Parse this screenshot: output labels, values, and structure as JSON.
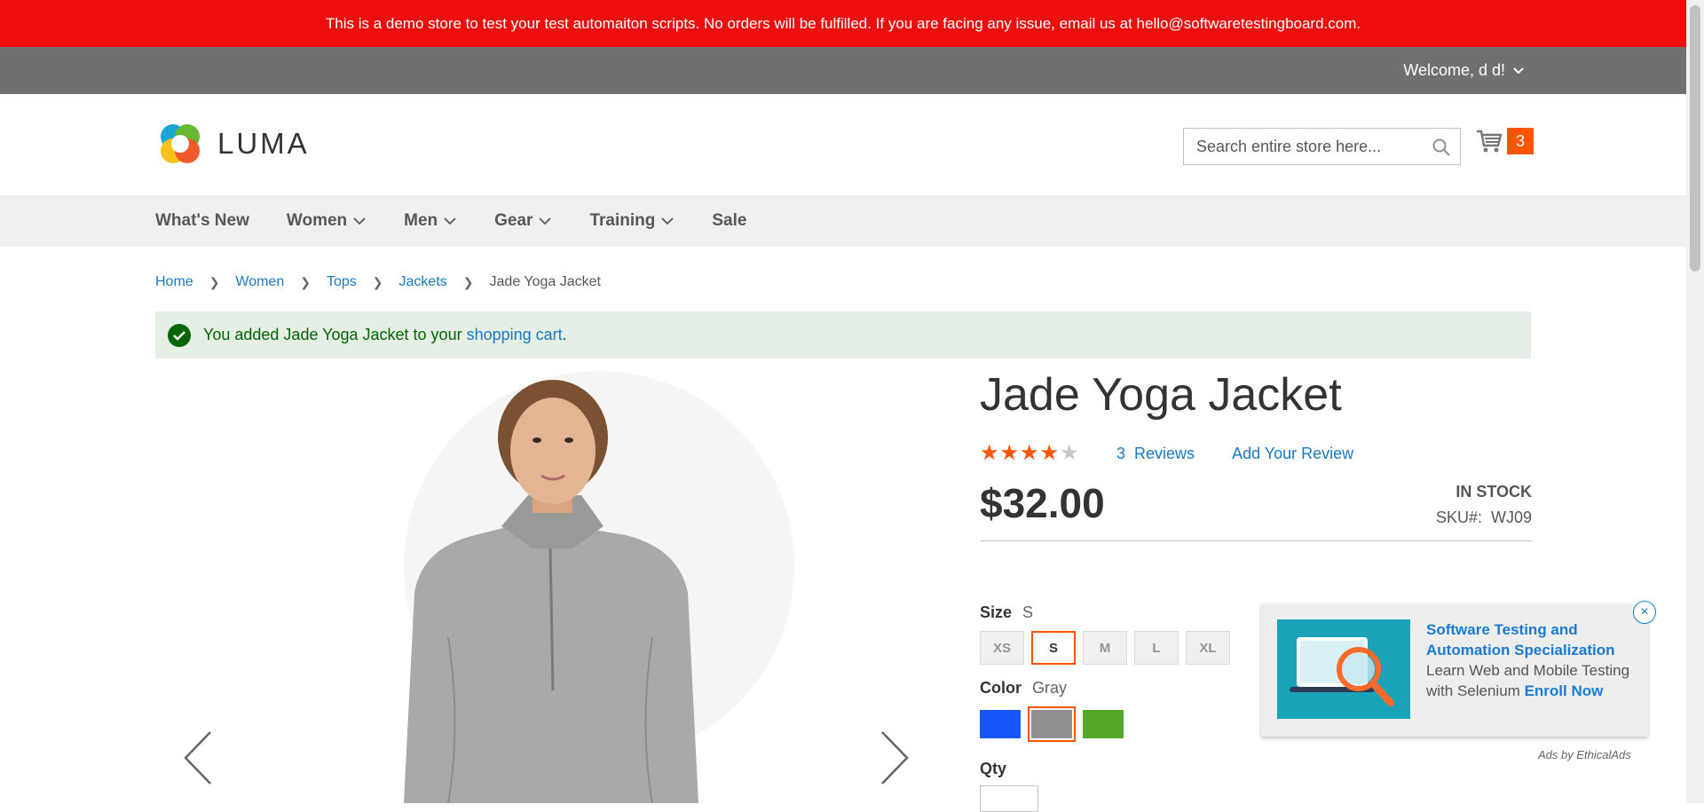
{
  "banner": {
    "text": "This is a demo store to test your test automaiton scripts. No orders will be fulfilled. If you are facing any issue, email us at hello@softwaretestingboard.com."
  },
  "top_bar": {
    "welcome": "Welcome, d d!"
  },
  "header": {
    "logo_text": "LUMA",
    "search_placeholder": "Search entire store here...",
    "cart_count": "3"
  },
  "nav": {
    "items": [
      {
        "label": "What's New"
      },
      {
        "label": "Women"
      },
      {
        "label": "Men"
      },
      {
        "label": "Gear"
      },
      {
        "label": "Training"
      },
      {
        "label": "Sale"
      }
    ]
  },
  "breadcrumbs": [
    "Home",
    "Women",
    "Tops",
    "Jackets",
    "Jade Yoga Jacket"
  ],
  "message": {
    "prefix": "You added Jade Yoga Jacket to your ",
    "link": "shopping cart",
    "suffix": "."
  },
  "product": {
    "title": "Jade Yoga Jacket",
    "rating_fraction": 0.8,
    "reviews_count": "3",
    "reviews_label": "Reviews",
    "add_review": "Add Your Review",
    "price": "$32.00",
    "stock": "IN STOCK",
    "sku_label": "SKU#:",
    "sku_value": "WJ09",
    "size_label": "Size",
    "size_selected": "S",
    "sizes": [
      "XS",
      "S",
      "M",
      "L",
      "XL"
    ],
    "color_label": "Color",
    "color_selected": "Gray",
    "colors": [
      "#1857f7",
      "#8f8f8f",
      "#53a828"
    ],
    "qty_label": "Qty"
  },
  "ad": {
    "title": "Software Testing and Automation Specialization",
    "body": "Learn Web and Mobile Testing with Selenium",
    "cta": "Enroll Now",
    "close": "×",
    "ads_by": "Ads by EthicalAds"
  },
  "colors": {
    "banner": "#ef0e0e",
    "top_bar": "#6e716e",
    "accent": "#ff5501",
    "link": "#1979c3"
  }
}
